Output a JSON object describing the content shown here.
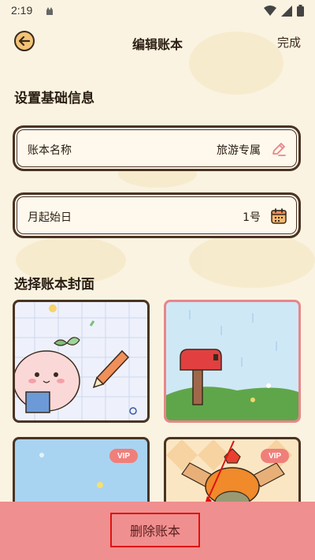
{
  "status_bar": {
    "time": "2:19"
  },
  "header": {
    "title": "编辑账本",
    "done_label": "完成"
  },
  "basic_info": {
    "section_title": "设置基础信息",
    "book_name": {
      "label": "账本名称",
      "value": "旅游专属",
      "icon": "pencil-icon"
    },
    "start_day": {
      "label": "月起始日",
      "value": "1号",
      "icon": "calendar-icon"
    }
  },
  "covers": {
    "section_title": "选择账本封面",
    "items": [
      {
        "name": "peach-sprout",
        "vip": ""
      },
      {
        "name": "red-mailbox",
        "vip": ""
      },
      {
        "name": "blue-sky",
        "vip": "VIP"
      },
      {
        "name": "orange-character",
        "vip": "VIP"
      }
    ]
  },
  "footer": {
    "delete_label": "删除账本"
  },
  "colors": {
    "background": "#fbf3e1",
    "border": "#4a3323",
    "accent": "#f08f8f",
    "highlight": "#e01010"
  }
}
